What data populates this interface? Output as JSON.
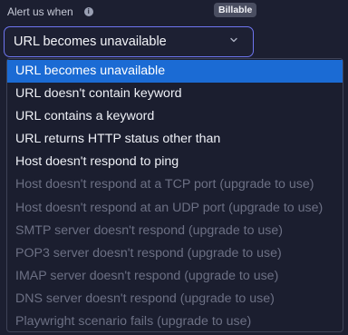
{
  "field": {
    "label": "Alert us when",
    "info_icon": "info-icon",
    "badge": "Billable"
  },
  "select": {
    "value": "URL becomes unavailable",
    "icon": "chevron-down-icon",
    "accent_color": "#6e75f0"
  },
  "options": [
    {
      "label": "URL becomes unavailable",
      "state": "selected"
    },
    {
      "label": "URL doesn't contain keyword",
      "state": "enabled"
    },
    {
      "label": "URL contains a keyword",
      "state": "enabled"
    },
    {
      "label": "URL returns HTTP status other than",
      "state": "enabled"
    },
    {
      "label": "Host doesn't respond to ping",
      "state": "enabled"
    },
    {
      "label": "Host doesn't respond at a TCP port (upgrade to use)",
      "state": "disabled"
    },
    {
      "label": "Host doesn't respond at an UDP port (upgrade to use)",
      "state": "disabled"
    },
    {
      "label": "SMTP server doesn't respond (upgrade to use)",
      "state": "disabled"
    },
    {
      "label": "POP3 server doesn't respond (upgrade to use)",
      "state": "disabled"
    },
    {
      "label": "IMAP server doesn't respond (upgrade to use)",
      "state": "disabled"
    },
    {
      "label": "DNS server doesn't respond (upgrade to use)",
      "state": "disabled"
    },
    {
      "label": "Playwright scenario fails (upgrade to use)",
      "state": "disabled"
    }
  ],
  "colors": {
    "background": "#1c1f31",
    "selected_option": "#1b6bd4",
    "disabled_text": "#6c7084"
  }
}
